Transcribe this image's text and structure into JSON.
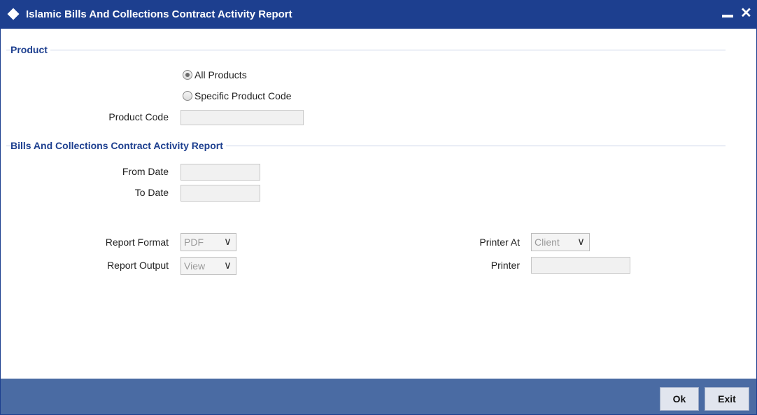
{
  "window": {
    "title": "Islamic Bills And Collections Contract Activity Report"
  },
  "product_section": {
    "heading": "Product",
    "radio_all": "All Products",
    "radio_specific": "Specific Product Code",
    "selected": "all",
    "product_code_label": "Product Code",
    "product_code_value": ""
  },
  "activity_section": {
    "heading": "Bills And Collections Contract Activity Report",
    "from_date_label": "From Date",
    "from_date_value": "",
    "to_date_label": "To Date",
    "to_date_value": ""
  },
  "report_options": {
    "format_label": "Report Format",
    "format_value": "PDF",
    "output_label": "Report Output",
    "output_value": "View",
    "printer_at_label": "Printer At",
    "printer_at_value": "Client",
    "printer_label": "Printer",
    "printer_value": ""
  },
  "footer": {
    "ok_label": "Ok",
    "exit_label": "Exit"
  },
  "colors": {
    "titlebar": "#1d3f8f",
    "footer": "#4a6ba3",
    "section_heading": "#1d3f8f"
  }
}
